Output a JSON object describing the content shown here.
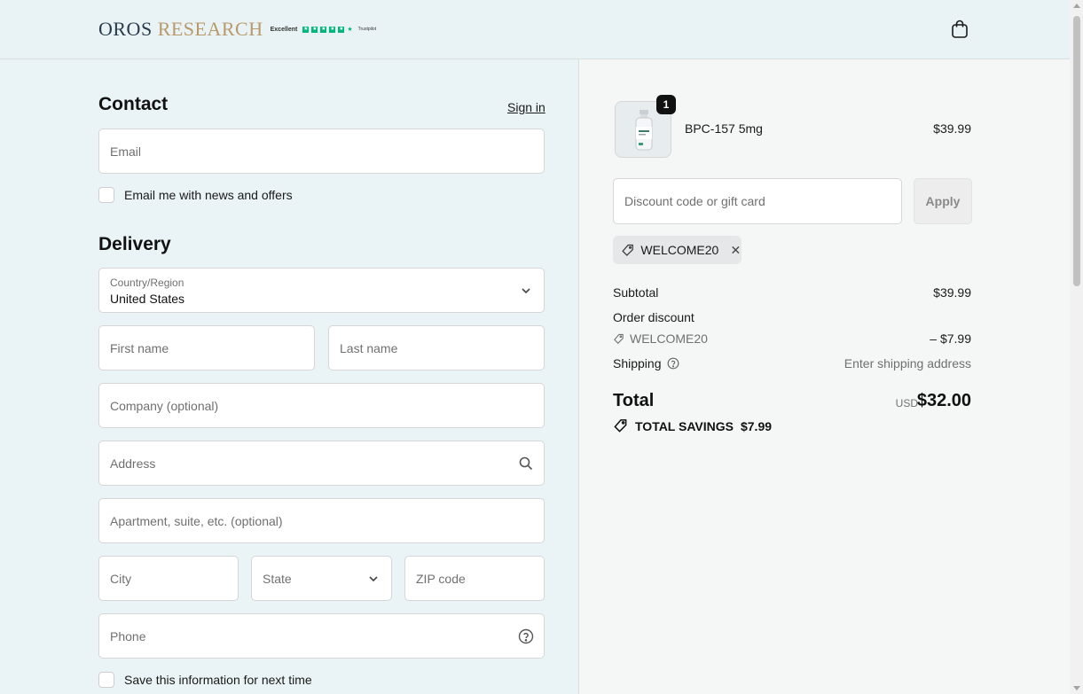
{
  "header": {
    "logo_main": "OROS",
    "logo_accent": "RESEARCH",
    "trustpilot_rating": "Excellent",
    "trustpilot_brand": "Trustpilot",
    "cart_icon": "shopping-bag-icon"
  },
  "contact": {
    "title": "Contact",
    "sign_in": "Sign in",
    "email_placeholder": "Email",
    "newsletter_label": "Email me with news and offers"
  },
  "delivery": {
    "title": "Delivery",
    "country_label": "Country/Region",
    "country_value": "United States",
    "first_name_placeholder": "First name",
    "last_name_placeholder": "Last name",
    "company_placeholder": "Company (optional)",
    "address_placeholder": "Address",
    "apartment_placeholder": "Apartment, suite, etc. (optional)",
    "city_placeholder": "City",
    "state_placeholder": "State",
    "zip_placeholder": "ZIP code",
    "phone_placeholder": "Phone",
    "save_info_label": "Save this information for next time"
  },
  "summary": {
    "item": {
      "name": "BPC-157 5mg",
      "price": "$39.99",
      "quantity": "1"
    },
    "discount_placeholder": "Discount code or gift card",
    "apply_label": "Apply",
    "applied_code": "WELCOME20",
    "subtotal_label": "Subtotal",
    "subtotal_value": "$39.99",
    "order_discount_label": "Order discount",
    "discount_code": "WELCOME20",
    "discount_value": "– $7.99",
    "shipping_label": "Shipping",
    "shipping_value": "Enter shipping address",
    "total_label": "Total",
    "total_currency": "USD",
    "total_value": "$32.00",
    "savings_label": "TOTAL SAVINGS",
    "savings_value": "$7.99"
  },
  "colors": {
    "left_background": "#eaf3f6",
    "right_background": "#f5f7f7",
    "logo_accent": "#b89a6a",
    "trustpilot_green": "#00b67a"
  }
}
